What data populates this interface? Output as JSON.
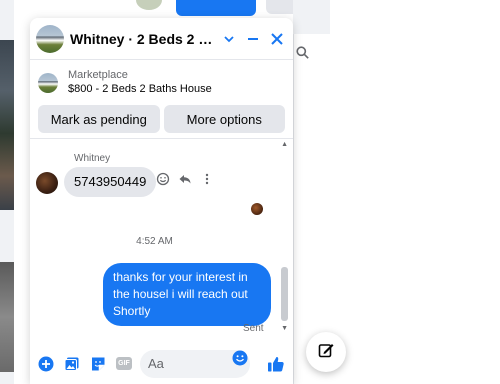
{
  "colors": {
    "accent": "#1877f2",
    "bubble_in": "#e4e6eb",
    "muted": "#65676b",
    "text": "#050505"
  },
  "chat": {
    "title": "Whitney · 2 Beds 2 Baths ...",
    "header_icons": [
      "chevron-down-icon",
      "minimize-icon",
      "close-icon"
    ]
  },
  "listing": {
    "kind": "Marketplace",
    "title": "$800 - 2 Beds 2 Baths House",
    "buttons": {
      "pending": "Mark as pending",
      "more": "More options"
    }
  },
  "messages": {
    "sender_name": "Whitney",
    "incoming_text": "5743950449",
    "timestamp": "4:52 AM",
    "outgoing_text": "thanks for your interest in the housel i will reach out Shortly",
    "status": "Sent"
  },
  "composer": {
    "placeholder": "Aa",
    "gif_label": "GIF",
    "icons": [
      "plus-icon",
      "photo-icon",
      "sticker-icon",
      "gif-icon",
      "emoji-icon",
      "thumbs-up-icon"
    ]
  }
}
